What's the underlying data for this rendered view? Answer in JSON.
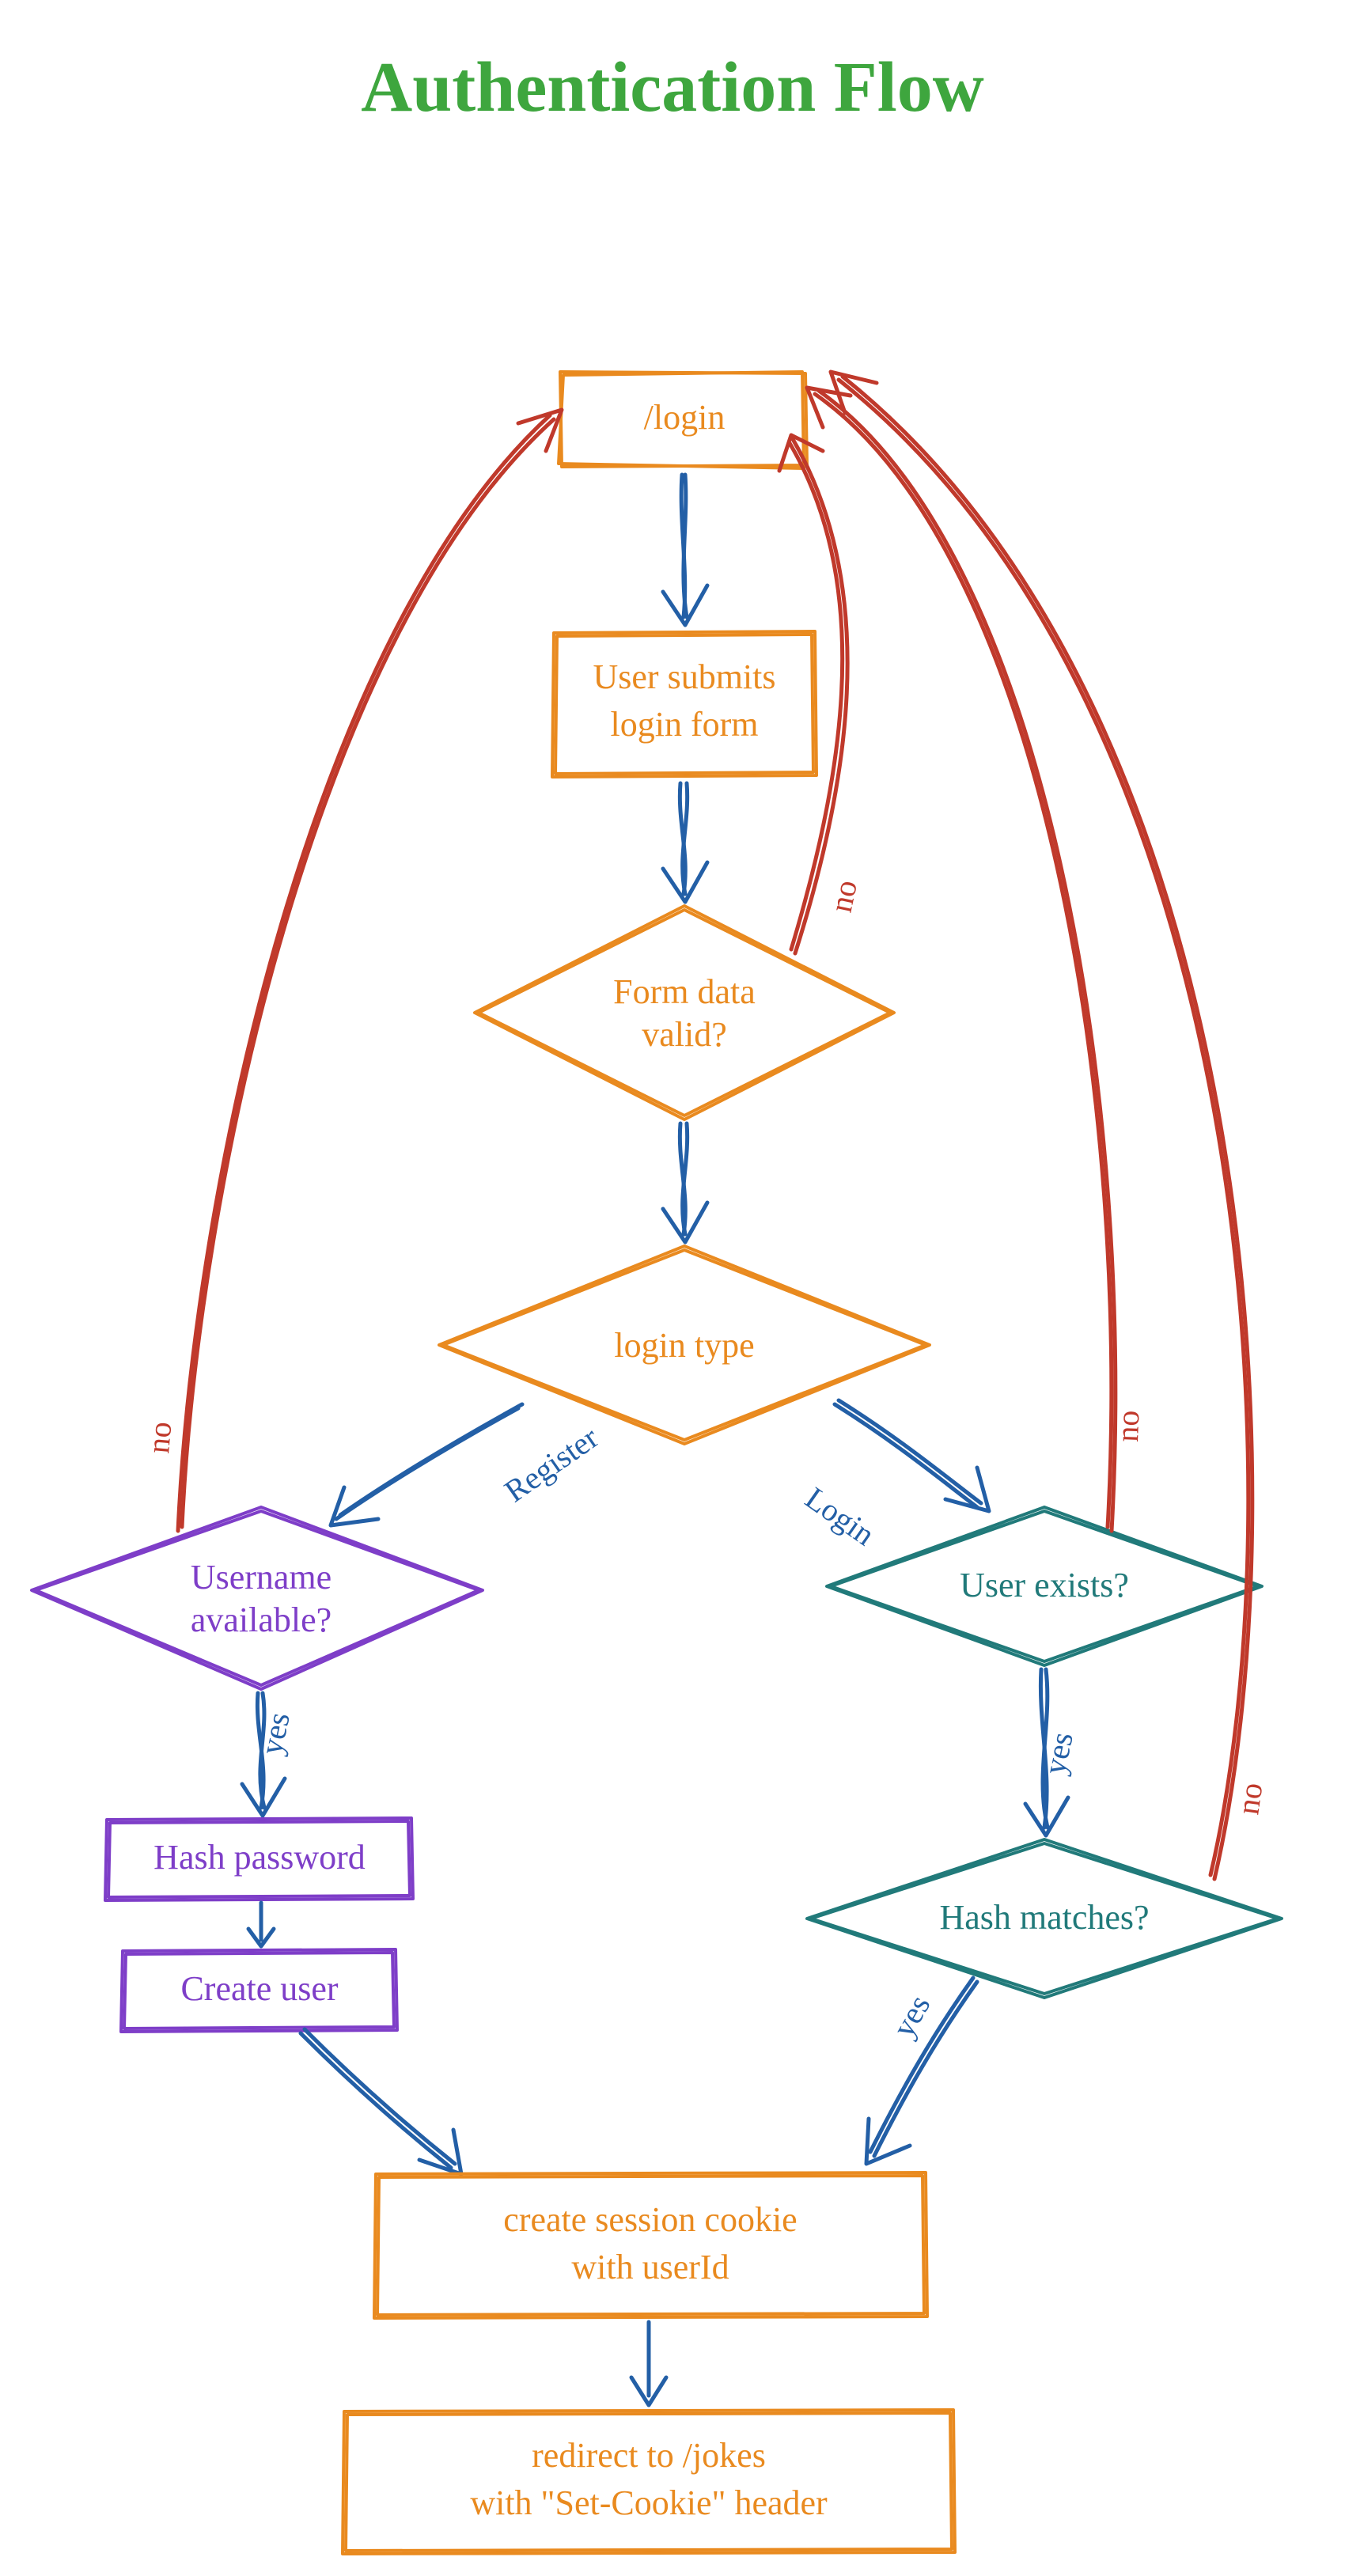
{
  "title": "Authentication Flow",
  "nodes": {
    "login": {
      "label": "/login"
    },
    "submit": {
      "line1": "User submits",
      "line2": "login form"
    },
    "formValid": {
      "line1": "Form data",
      "line2": "valid?"
    },
    "loginType": {
      "label": "login type"
    },
    "usernameAvail": {
      "line1": "Username",
      "line2": "available?"
    },
    "userExists": {
      "label": "User exists?"
    },
    "hashPassword": {
      "label": "Hash password"
    },
    "createUser": {
      "label": "Create user"
    },
    "hashMatches": {
      "label": "Hash matches?"
    },
    "createSession": {
      "line1": "create session cookie",
      "line2": "with userId"
    },
    "redirect": {
      "line1": "redirect to /jokes",
      "line2": "with \"Set-Cookie\" header"
    }
  },
  "edgeLabels": {
    "register": "Register",
    "loginBranch": "Login",
    "yes1": "yes",
    "yes2": "yes",
    "yes3": "yes",
    "no1": "no",
    "no2": "no",
    "no3": "no",
    "no4": "no"
  },
  "colors": {
    "title": "#3ea63e",
    "orange": "#e98a1f",
    "purple": "#7e3ec8",
    "teal": "#217a7a",
    "blue": "#235fa6",
    "red": "#c0392b"
  }
}
